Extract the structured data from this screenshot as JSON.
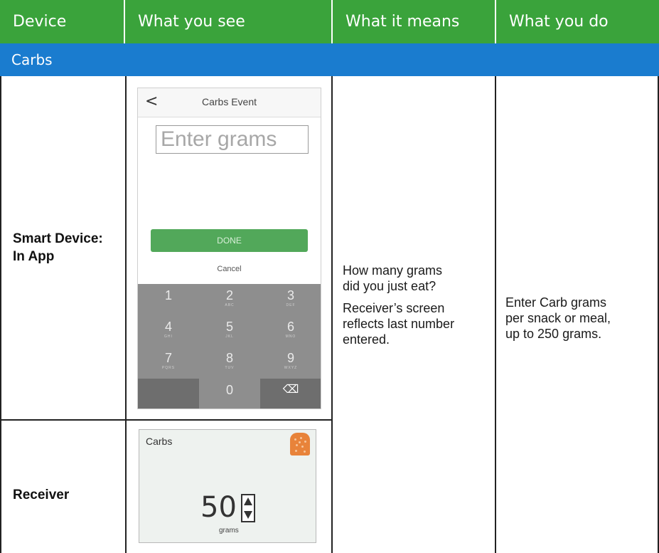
{
  "header": {
    "col1": "Device",
    "col2": "What you see",
    "col3": "What it means",
    "col4": "What you do"
  },
  "section": {
    "title": "Carbs"
  },
  "rows": {
    "smart_device_label_line1": "Smart Device:",
    "smart_device_label_line2": "In App",
    "receiver_label": "Receiver"
  },
  "means": {
    "line1": "How many grams",
    "line2": "did you just eat?",
    "line3": "Receiver’s screen",
    "line4": "reflects last number",
    "line5": "entered."
  },
  "do": {
    "line1": "Enter Carb grams",
    "line2": "per snack or meal,",
    "line3": "up to 250 grams."
  },
  "phone": {
    "back_glyph": "<",
    "title": "Carbs Event",
    "input_placeholder": "Enter grams",
    "done_label": "DONE",
    "cancel_label": "Cancel",
    "keys": [
      {
        "num": "1",
        "sub": ""
      },
      {
        "num": "2",
        "sub": "ABC"
      },
      {
        "num": "3",
        "sub": "DEF"
      },
      {
        "num": "4",
        "sub": "GHI"
      },
      {
        "num": "5",
        "sub": "JKL"
      },
      {
        "num": "6",
        "sub": "MNO"
      },
      {
        "num": "7",
        "sub": "PQRS"
      },
      {
        "num": "8",
        "sub": "TUV"
      },
      {
        "num": "9",
        "sub": "WXYZ"
      },
      {
        "num": "",
        "sub": ""
      },
      {
        "num": "0",
        "sub": ""
      },
      {
        "num": "⌫",
        "sub": ""
      }
    ]
  },
  "receiver": {
    "title": "Carbs",
    "value": "50",
    "unit": "grams"
  },
  "colors": {
    "header_green": "#3aa33b",
    "section_blue": "#1a7ccf",
    "done_green": "#52a85a",
    "carb_icon_orange": "#e8833a"
  }
}
